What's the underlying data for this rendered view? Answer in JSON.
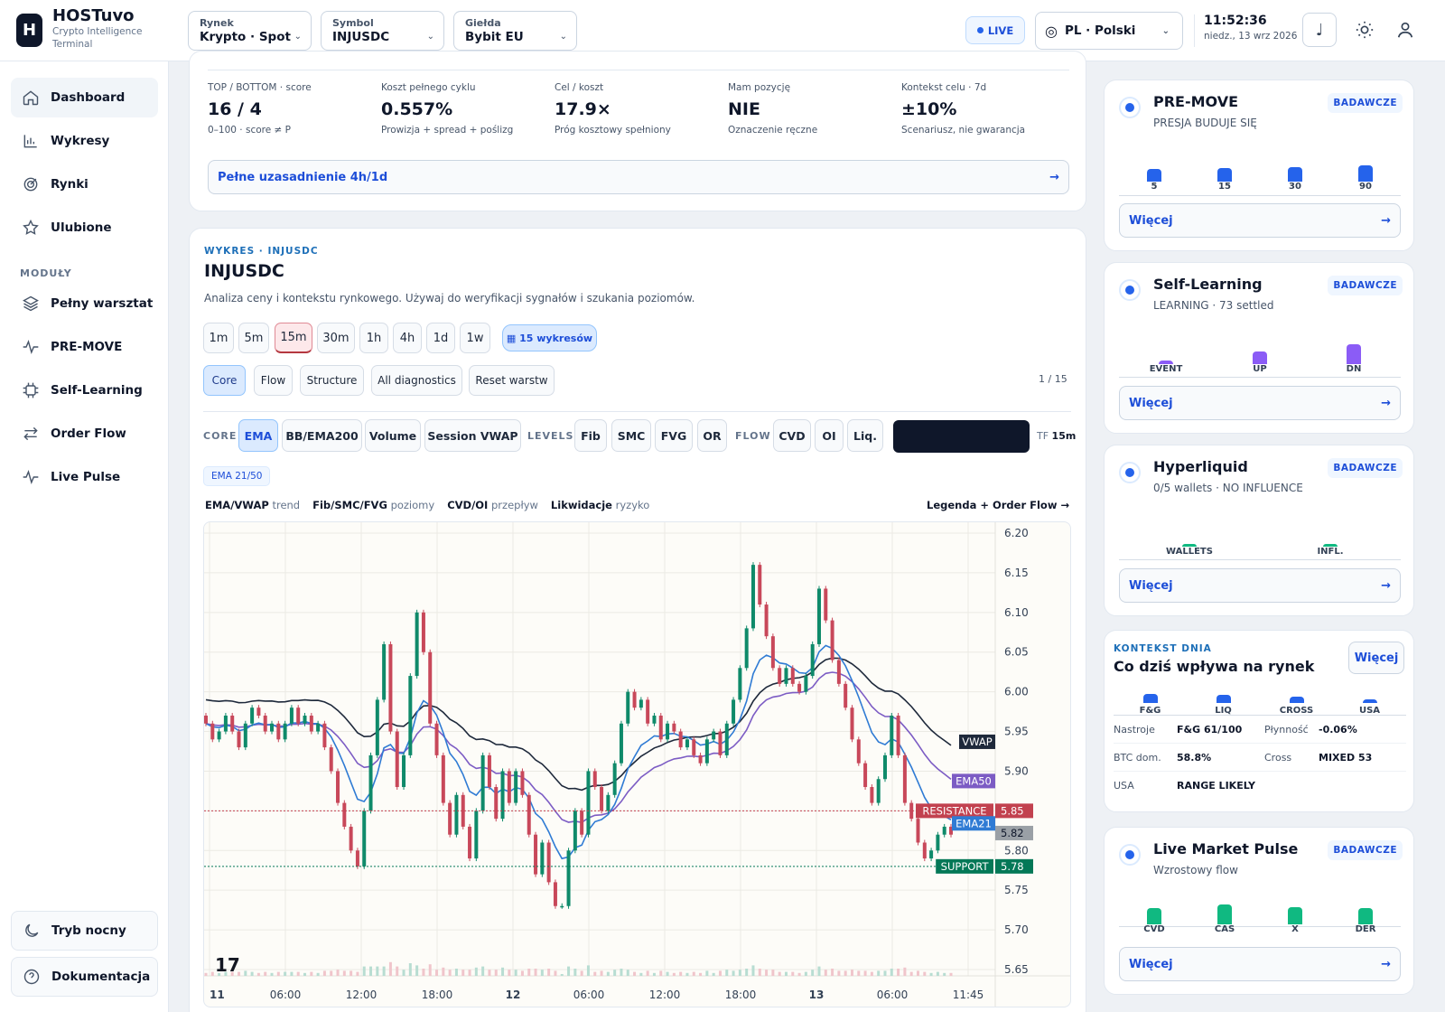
{
  "app": {
    "logo_letter": "H",
    "name": "HOSTuvo",
    "subtitle_1": "Crypto Intelligence",
    "subtitle_2": "Terminal"
  },
  "header": {
    "market": {
      "label": "Rynek",
      "value": "Krypto · Spot"
    },
    "symbol": {
      "label": "Symbol",
      "value": "INJUSDC"
    },
    "exchange": {
      "label": "Giełda",
      "value": "Bybit EU"
    },
    "live": "LIVE",
    "language": "PL · Polski",
    "time": "11:52:36",
    "date": "niedz., 13 wrz 2026"
  },
  "sidebar": {
    "items": [
      {
        "label": "Dashboard",
        "icon": "home-icon",
        "active": true
      },
      {
        "label": "Wykresy",
        "icon": "bar-chart-icon"
      },
      {
        "label": "Rynki",
        "icon": "target-icon"
      },
      {
        "label": "Ulubione",
        "icon": "star-icon"
      }
    ],
    "section": "MODUŁY",
    "modules": [
      {
        "label": "Pełny warsztat",
        "icon": "layers-icon"
      },
      {
        "label": "PRE-MOVE",
        "icon": "pulse-icon"
      },
      {
        "label": "Self-Learning",
        "icon": "cpu-icon"
      },
      {
        "label": "Order Flow",
        "icon": "arrows-icon"
      },
      {
        "label": "Live Pulse",
        "icon": "pulse-icon"
      }
    ],
    "night_mode": "Tryb nocny",
    "docs": "Dokumentacja"
  },
  "summary": {
    "metrics": [
      {
        "label": "TOP / BOTTOM · score",
        "value": "16 / 4",
        "sub": "0–100 · score ≠ P"
      },
      {
        "label": "Koszt pełnego cyklu",
        "value": "0.557%",
        "sub": "Prowizja + spread + poślizg"
      },
      {
        "label": "Cel / koszt",
        "value": "17.9×",
        "sub": "Próg kosztowy spełniony"
      },
      {
        "label": "Mam pozycję",
        "value": "NIE",
        "sub": "Oznaczenie ręczne"
      },
      {
        "label": "Kontekst celu · 7d",
        "value": "±10%",
        "sub": "Scenariusz, nie gwarancja"
      }
    ],
    "full_button": "Pełne uzasadnienie 4h/1d",
    "arrow": "→"
  },
  "chart_panel": {
    "eyebrow": "WYKRES · INJUSDC",
    "title": "INJUSDC",
    "description": "Analiza ceny i kontekstu rynkowego. Używaj do weryfikacji sygnałów i szukania poziomów.",
    "timeframes": [
      "1m",
      "5m",
      "15m",
      "30m",
      "1h",
      "4h",
      "1d",
      "1w"
    ],
    "active_timeframe": "15m",
    "charts_button": "▦ 15 wykresów",
    "presets": [
      "Core",
      "Flow",
      "Structure",
      "All diagnostics",
      "Reset warstw"
    ],
    "active_preset": "Core",
    "page_counter": "1 / 15",
    "toolbar": {
      "core_label": "CORE",
      "core": [
        "EMA",
        "BB/EMA200",
        "Volume",
        "Session VWAP"
      ],
      "levels_label": "LEVELS",
      "levels": [
        "Fib",
        "SMC",
        "FVG",
        "OR"
      ],
      "flow_label": "FLOW",
      "flow": [
        "CVD",
        "OI",
        "Liq."
      ],
      "tf_label": "TF",
      "tf_value": "15m"
    },
    "ema_chip": "EMA 21/50",
    "legend": [
      {
        "bold": "EMA/VWAP",
        "text": "trend"
      },
      {
        "bold": "Fib/SMC/FVG",
        "text": "poziomy"
      },
      {
        "bold": "CVD/OI",
        "text": "przepływ"
      },
      {
        "bold": "Likwidacje",
        "text": "ryzyko"
      }
    ],
    "legend_link": "Legenda + Order Flow →"
  },
  "chart_data": {
    "type": "candlestick",
    "y_ticks": [
      "6.20",
      "6.15",
      "6.10",
      "6.05",
      "6.00",
      "5.95",
      "5.90",
      "5.80",
      "5.75",
      "5.70",
      "5.65"
    ],
    "ylim": [
      5.65,
      6.2
    ],
    "x_ticks": [
      {
        "label": "11",
        "bold": true
      },
      {
        "label": "06:00"
      },
      {
        "label": "12:00"
      },
      {
        "label": "18:00"
      },
      {
        "label": "12",
        "bold": true
      },
      {
        "label": "06:00"
      },
      {
        "label": "12:00"
      },
      {
        "label": "18:00"
      },
      {
        "label": "13",
        "bold": true
      },
      {
        "label": "06:00"
      },
      {
        "label": "11:45"
      }
    ],
    "levels": [
      {
        "name": "RESISTANCE",
        "value": 5.85,
        "color": "#c2414f",
        "label": "5.85"
      },
      {
        "name": "SUPPORT",
        "value": 5.78,
        "color": "#047857",
        "label": "5.78"
      }
    ],
    "last_price": {
      "label": "5.82",
      "value": 5.822
    },
    "line_tags": [
      {
        "name": "VWAP",
        "color": "#1e293b"
      },
      {
        "name": "EMA50",
        "color": "#7c5cc4"
      },
      {
        "name": "EMA21",
        "color": "#2f7bd4"
      }
    ],
    "colors": {
      "up": "#0f8a6a",
      "down": "#c8485a"
    },
    "close": [
      5.96,
      5.94,
      5.95,
      5.97,
      5.95,
      5.93,
      5.96,
      5.98,
      5.97,
      5.95,
      5.96,
      5.94,
      5.96,
      5.98,
      5.96,
      5.97,
      5.95,
      5.96,
      5.93,
      5.9,
      5.86,
      5.83,
      5.8,
      5.78,
      5.85,
      5.92,
      5.99,
      6.06,
      5.95,
      5.88,
      5.92,
      6.02,
      6.1,
      6.05,
      5.96,
      5.92,
      5.86,
      5.82,
      5.87,
      5.83,
      5.79,
      5.85,
      5.92,
      5.88,
      5.84,
      5.9,
      5.86,
      5.9,
      5.87,
      5.82,
      5.77,
      5.81,
      5.76,
      5.73,
      5.73,
      5.8,
      5.85,
      5.82,
      5.9,
      5.88,
      5.85,
      5.87,
      5.91,
      5.96,
      6.0,
      5.98,
      5.99,
      5.96,
      5.97,
      5.94,
      5.96,
      5.95,
      5.93,
      5.94,
      5.92,
      5.91,
      5.94,
      5.95,
      5.92,
      5.96,
      5.99,
      6.03,
      6.08,
      6.16,
      6.11,
      6.07,
      6.03,
      6.01,
      6.03,
      6.01,
      6.0,
      6.02,
      6.06,
      6.13,
      6.09,
      6.04,
      6.01,
      5.98,
      5.94,
      5.91,
      5.88,
      5.86,
      5.89,
      5.92,
      5.97,
      5.92,
      5.86,
      5.84,
      5.81,
      5.79,
      5.8,
      5.82,
      5.83,
      5.82
    ]
  },
  "right_panel": {
    "cards": [
      {
        "title": "PRE-MOVE",
        "subtitle": "PRESJA BUDUJE SIĘ",
        "badge": "BADAWCZE",
        "more": "Więcej",
        "bars": [
          {
            "label": "5",
            "level": 0.7
          },
          {
            "label": "15",
            "level": 0.75
          },
          {
            "label": "30",
            "level": 0.8
          },
          {
            "label": "90",
            "level": 0.9
          }
        ],
        "color": "#2563eb"
      },
      {
        "title": "Self-Learning",
        "subtitle": "LEARNING · 73 settled",
        "badge": "BADAWCZE",
        "more": "Więcej",
        "bars": [
          {
            "label": "EVENT",
            "level": 0.2
          },
          {
            "label": "UP",
            "level": 0.65
          },
          {
            "label": "DN",
            "level": 1.0
          }
        ],
        "color": "#8b5cf6"
      },
      {
        "title": "Hyperliquid",
        "subtitle": "0/5 wallets · NO INFLUENCE",
        "badge": "BADAWCZE",
        "more": "Więcej",
        "bars": [
          {
            "label": "WALLETS",
            "level": 0.15
          },
          {
            "label": "INFL.",
            "level": 0.15
          }
        ],
        "color": "#10b981"
      },
      {
        "title": "Live Market Pulse",
        "subtitle": "Wzrostowy flow",
        "badge": "BADAWCZE",
        "more": "Więcej",
        "bars": [
          {
            "label": "CVD",
            "level": 0.8
          },
          {
            "label": "CAS",
            "level": 1.0
          },
          {
            "label": "X",
            "level": 0.85
          },
          {
            "label": "DER",
            "level": 0.8
          }
        ],
        "color": "#10b981"
      }
    ],
    "context": {
      "eyebrow": "KONTEKST DNIA",
      "title": "Co dziś wpływa na rynek",
      "more": "Więcej",
      "bars": [
        {
          "label": "F&G",
          "level": 0.7
        },
        {
          "label": "LIQ",
          "level": 0.65
        },
        {
          "label": "CROSS",
          "level": 0.5
        },
        {
          "label": "USA",
          "level": 0.3
        }
      ],
      "rows": [
        {
          "k1": "Nastroje",
          "v1": "F&G 61/100",
          "k2": "Płynność",
          "v2": "-0.06%"
        },
        {
          "k1": "BTC dom.",
          "v1": "58.8%",
          "k2": "Cross",
          "v2": "MIXED 53"
        },
        {
          "k1": "USA",
          "v1": "RANGE LIKELY",
          "k2": "",
          "v2": ""
        }
      ]
    }
  }
}
